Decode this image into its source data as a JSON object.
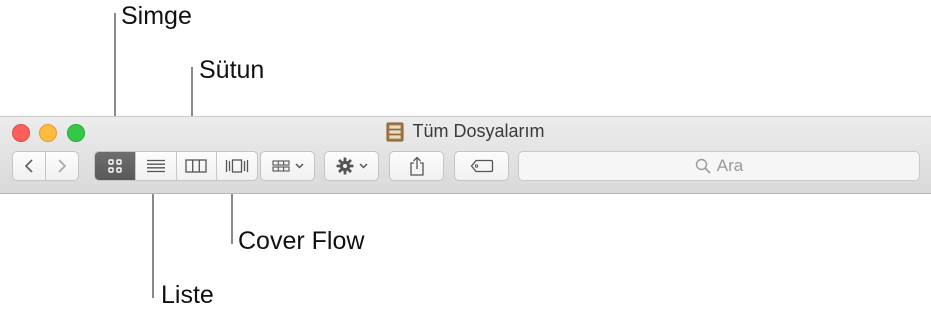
{
  "callouts": {
    "icon": "Simge",
    "column": "Sütun",
    "cover_flow": "Cover Flow",
    "list": "Liste"
  },
  "window": {
    "title": "Tüm Dosyalarım",
    "title_icon": "drawer-cabinet-icon"
  },
  "toolbar": {
    "nav": [
      "chevron-left-icon",
      "chevron-right-icon"
    ],
    "view_modes": [
      {
        "name": "icon-view",
        "icon": "grid-icon",
        "active": true
      },
      {
        "name": "list-view",
        "icon": "list-icon",
        "active": false
      },
      {
        "name": "column-view",
        "icon": "columns-icon",
        "active": false
      },
      {
        "name": "cover-flow-view",
        "icon": "cover-flow-icon",
        "active": false
      }
    ],
    "arrange_icon": "arrange-grid-icon",
    "action_icon": "gear-icon",
    "share_icon": "share-icon",
    "tag_icon": "tag-icon",
    "search_placeholder": "Ara"
  },
  "colors": {
    "close": "#fc605b",
    "minimize": "#fdbc40",
    "zoom": "#34c84a",
    "active_segment": "#616161"
  }
}
